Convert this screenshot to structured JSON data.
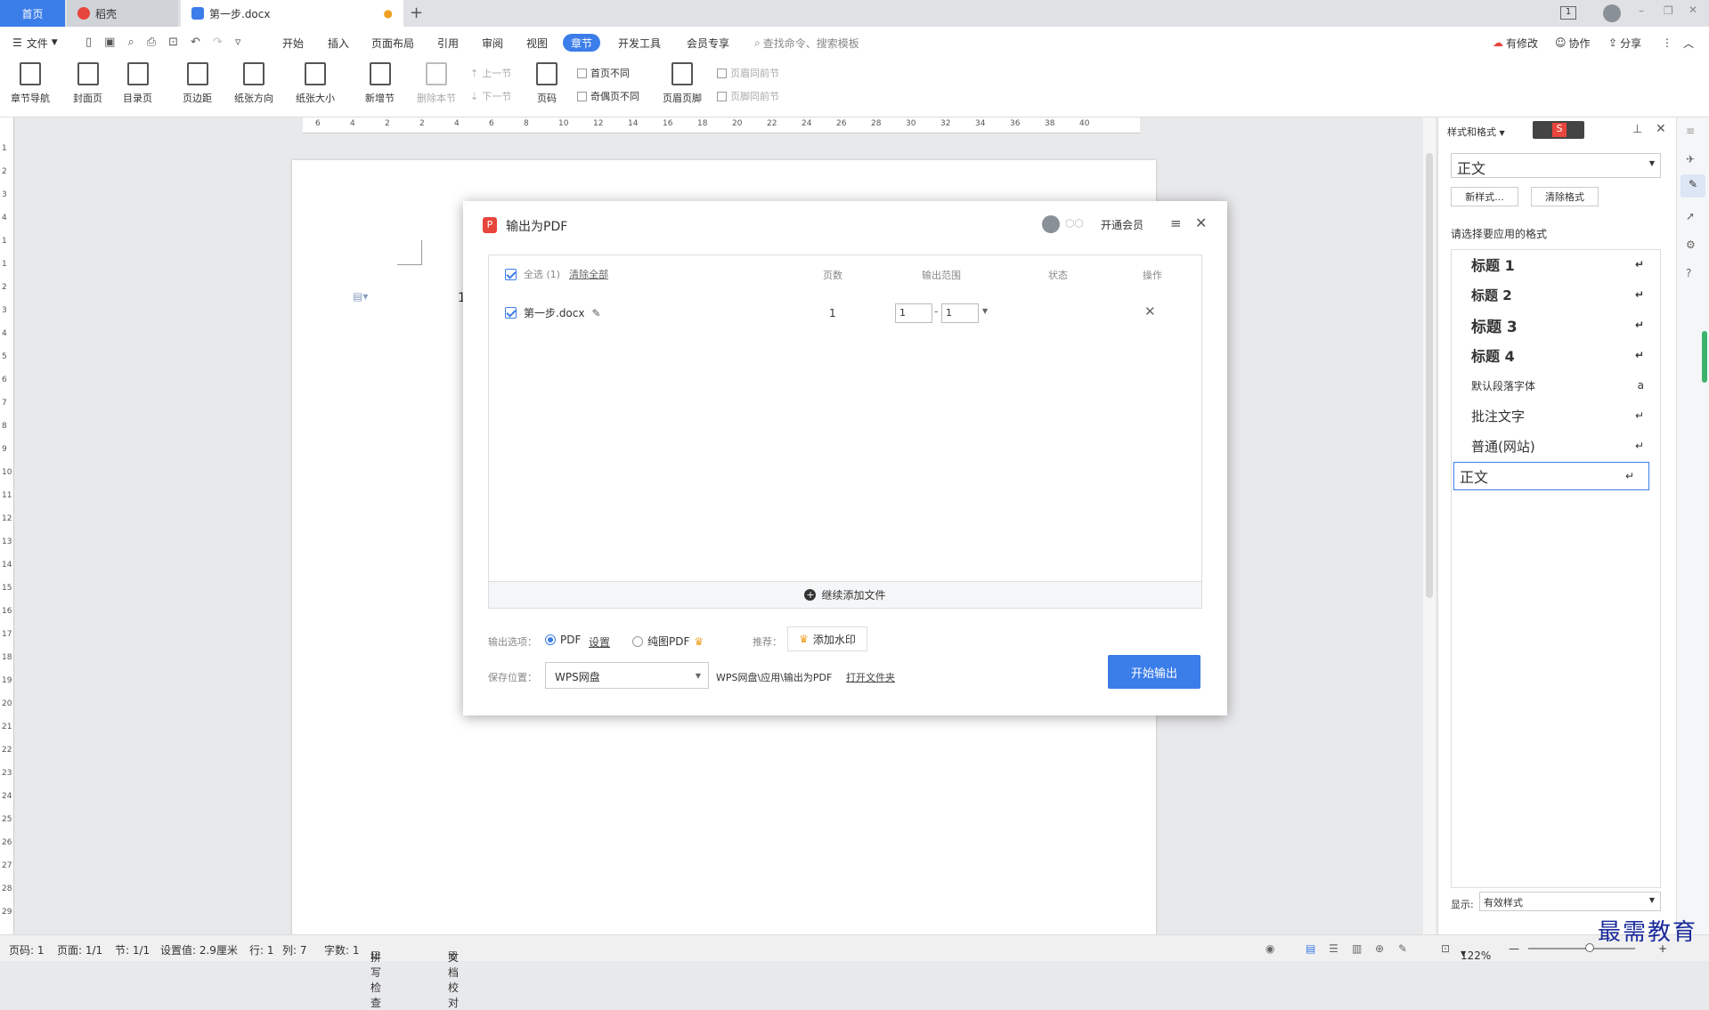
{
  "tabs": {
    "home": "首页",
    "daoke": "稻壳",
    "doc": "第一步.docx",
    "new_tab": "+"
  },
  "window": {
    "badge": "1"
  },
  "menu": {
    "file": "文件",
    "items": [
      "开始",
      "插入",
      "页面布局",
      "引用",
      "审阅",
      "视图",
      "章节",
      "开发工具",
      "会员专享"
    ],
    "active": "章节",
    "search": "查找命令、搜索模板",
    "right": [
      "有修改",
      "协作",
      "分享"
    ]
  },
  "ribbon": {
    "buttons": [
      "章节导航",
      "封面页",
      "目录页",
      "页边距",
      "纸张方向",
      "纸张大小",
      "新增节",
      "删除本节",
      "页码",
      "页眉页脚"
    ],
    "prev_section": "上一节",
    "next_section": "下一节",
    "checks": [
      "首页不同",
      "奇偶页不同",
      "页眉同前节",
      "页脚同前节"
    ]
  },
  "ruler": [
    "6",
    "4",
    "2",
    "2",
    "4",
    "6",
    "8",
    "10",
    "12",
    "14",
    "16",
    "18",
    "20",
    "22",
    "24",
    "26",
    "28",
    "30",
    "32",
    "34",
    "36",
    "38",
    "40"
  ],
  "vruler": [
    "1",
    "2",
    "3",
    "4",
    "1",
    "1",
    "2",
    "3",
    "4",
    "5",
    "6",
    "7",
    "8",
    "9",
    "10",
    "11",
    "12",
    "13",
    "14",
    "15",
    "16",
    "17",
    "18",
    "19",
    "20",
    "21",
    "22",
    "23",
    "24",
    "25",
    "26",
    "27",
    "28",
    "29"
  ],
  "document": {
    "char": "1"
  },
  "panel": {
    "title": "样式和格式",
    "current": "正文",
    "new_style": "新样式...",
    "clear_format": "清除格式",
    "prompt": "请选择要应用的格式",
    "styles": [
      {
        "label": "标题  1",
        "ret": "↵"
      },
      {
        "label": "标题  2",
        "ret": "↵"
      },
      {
        "label": "标题  3",
        "ret": "↵"
      },
      {
        "label": "标题  4",
        "ret": "↵"
      },
      {
        "label": "默认段落字体",
        "ret": "a"
      },
      {
        "label": "批注文字",
        "ret": "↵"
      },
      {
        "label": "普通(网站)",
        "ret": "↵"
      },
      {
        "label": "正文",
        "ret": "↵"
      }
    ],
    "show_label": "显示:",
    "show_value": "有效样式"
  },
  "dialog": {
    "title": "输出为PDF",
    "vip": "开通会员",
    "columns": {
      "select_all": "全选 (1)",
      "clear_all": "清除全部",
      "pages": "页数",
      "range": "输出范围",
      "status": "状态",
      "ops": "操作"
    },
    "file": {
      "name": "第一步.docx",
      "pages": "1",
      "from": "1",
      "to": "1",
      "dash": "-"
    },
    "add_file": "继续添加文件",
    "options_label": "输出选项：",
    "pdf": "PDF",
    "settings": "设置",
    "pure_pdf": "纯图PDF",
    "recommend": "推荐：",
    "watermark": "添加水印",
    "save_label": "保存位置：",
    "save_value": "WPS网盘",
    "save_path": "WPS网盘\\应用\\输出为PDF",
    "open_folder": "打开文件夹",
    "start": "开始输出"
  },
  "status": {
    "page_code": "页码: 1",
    "page": "页面: 1/1",
    "section": "节: 1/1",
    "setting": "设置值: 2.9厘米",
    "row": "行: 1",
    "col": "列: 7",
    "words": "字数: 1",
    "spell": "拼写检查",
    "proof": "文档校对",
    "zoom": "122%"
  },
  "watermark_logo": "最需教育",
  "colors": {
    "accent": "#3b7de9",
    "crown": "#f0a020",
    "pdf_red": "#e8453c"
  }
}
